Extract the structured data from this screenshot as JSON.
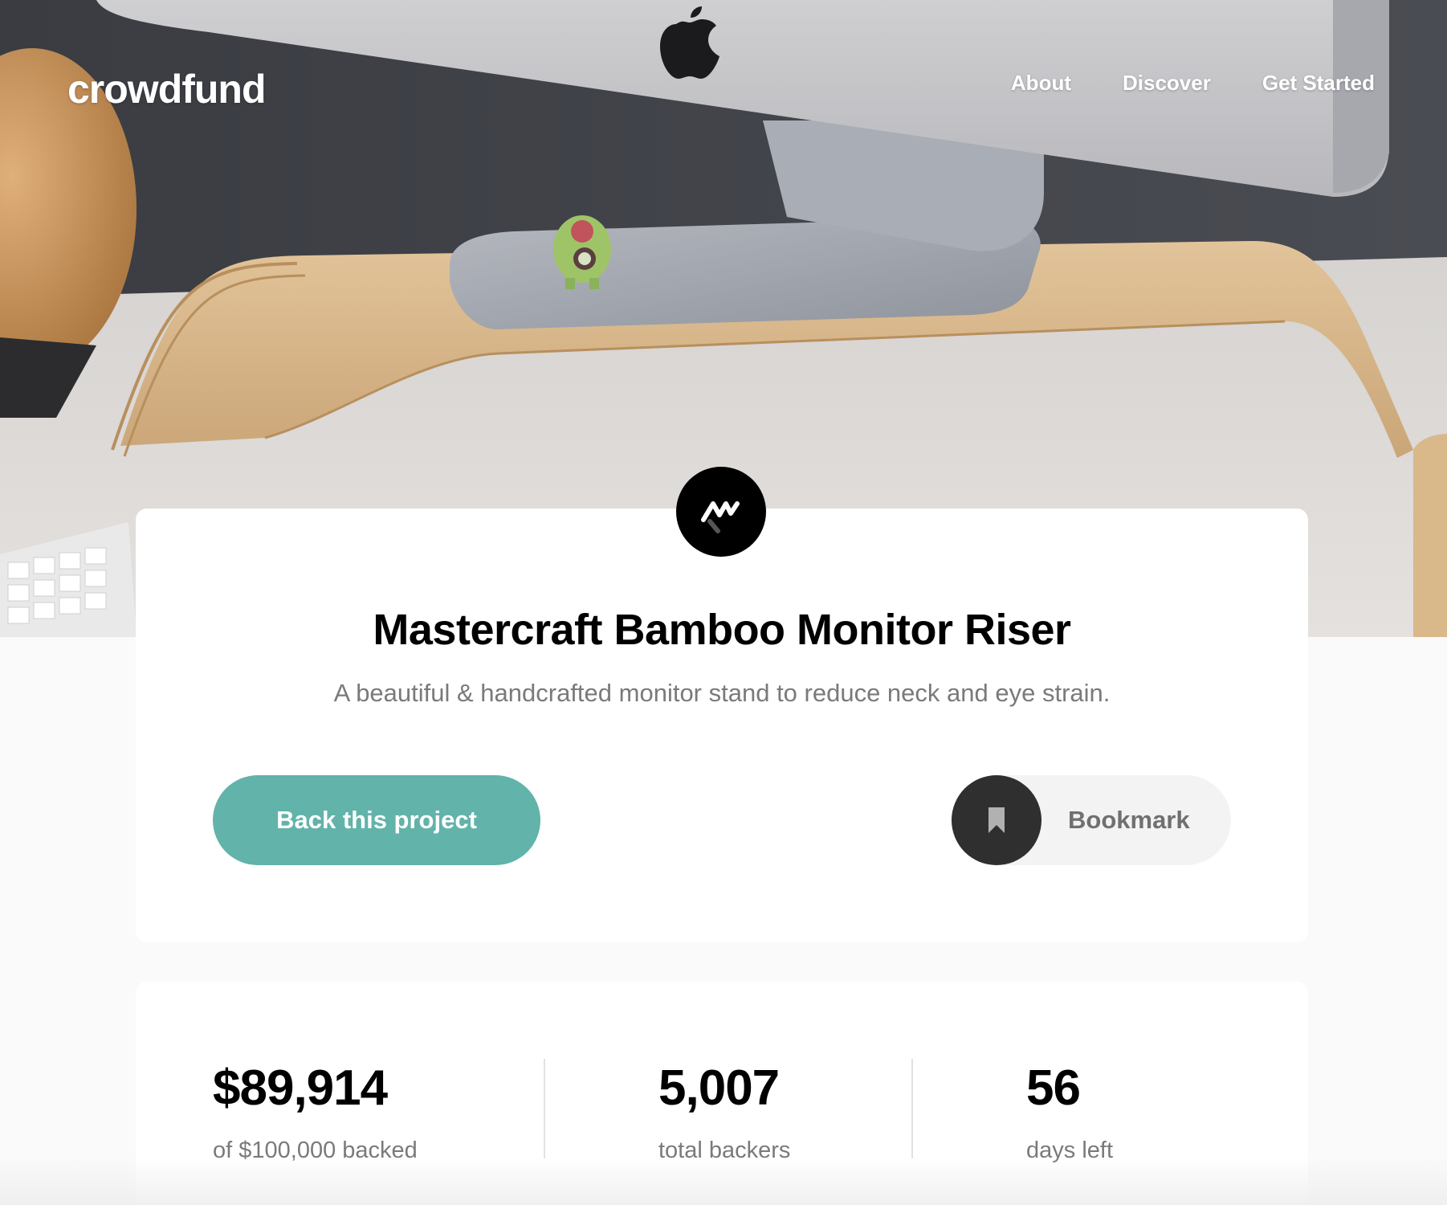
{
  "header": {
    "logo": "crowdfund",
    "nav": [
      {
        "label": "About"
      },
      {
        "label": "Discover"
      },
      {
        "label": "Get Started"
      }
    ]
  },
  "project": {
    "title": "Mastercraft Bamboo Monitor Riser",
    "description": "A beautiful & handcrafted monitor stand to reduce neck and eye strain.",
    "back_label": "Back this project",
    "bookmark_label": "Bookmark"
  },
  "stats": [
    {
      "value": "$89,914",
      "label": "of $100,000 backed"
    },
    {
      "value": "5,007",
      "label": "total backers"
    },
    {
      "value": "56",
      "label": "days left"
    }
  ],
  "colors": {
    "accent": "#62b3aa",
    "text_dark": "#000000",
    "text_muted": "#7a7a7a",
    "bookmark_circle": "#2f2f2f"
  },
  "icons": {
    "brand": "mastercraft-logo-icon",
    "bookmark": "bookmark-icon",
    "apple": "apple-logo-icon"
  }
}
